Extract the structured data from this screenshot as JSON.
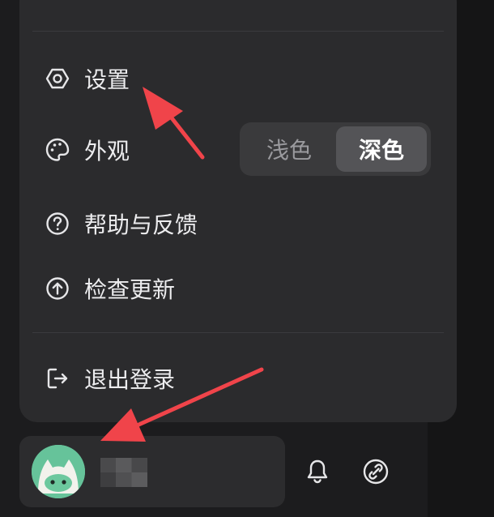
{
  "menu": {
    "items": [
      {
        "key": "settings",
        "label": "设置",
        "icon": "settings-hex-icon"
      },
      {
        "key": "appearance",
        "label": "外观",
        "icon": "palette-icon"
      },
      {
        "key": "help",
        "label": "帮助与反馈",
        "icon": "help-circle-icon"
      },
      {
        "key": "update",
        "label": "检查更新",
        "icon": "upload-circle-icon"
      },
      {
        "key": "logout",
        "label": "退出登录",
        "icon": "logout-icon"
      }
    ],
    "theme": {
      "options": [
        "浅色",
        "深色"
      ],
      "selected": "深色"
    }
  },
  "user": {
    "avatar": "cat-avatar-icon",
    "name": ""
  },
  "toolbar": {
    "icons": [
      "bell-icon",
      "link-icon"
    ]
  },
  "colors": {
    "background": "#1c1c1e",
    "menu": "#2b2b2d",
    "accent_arrow": "#f0444a",
    "avatar": "#66c39a"
  }
}
